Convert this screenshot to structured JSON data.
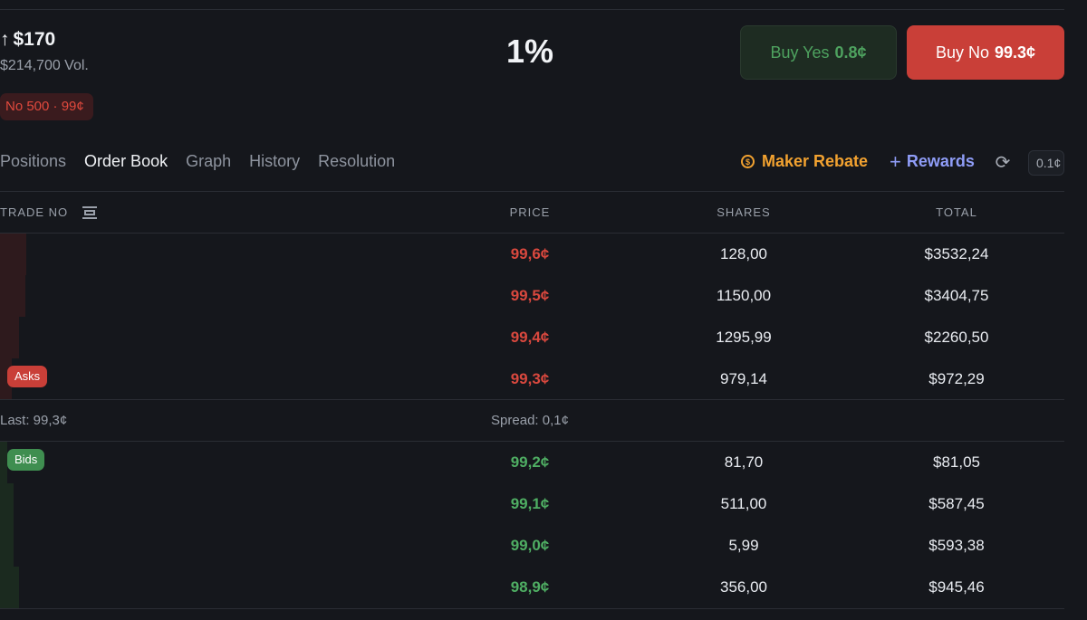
{
  "market": {
    "price_label": "$170",
    "volume": "$214,700 Vol.",
    "position_badge": "No 500 · 99¢",
    "chance": "1%"
  },
  "buttons": {
    "buy_yes_label": "Buy Yes",
    "buy_yes_price": "0.8¢",
    "buy_no_label": "Buy No",
    "buy_no_price": "99.3¢"
  },
  "tabs": [
    {
      "label": "Positions",
      "active": false
    },
    {
      "label": "Order Book",
      "active": true
    },
    {
      "label": "Graph",
      "active": false
    },
    {
      "label": "History",
      "active": false
    },
    {
      "label": "Resolution",
      "active": false
    }
  ],
  "toolbar": {
    "maker_rebate": "Maker Rebate",
    "rewards": "Rewards",
    "tick_size": "0.1¢"
  },
  "orderbook": {
    "columns": {
      "trade": "TRADE NO",
      "price": "PRICE",
      "shares": "SHARES",
      "total": "TOTAL"
    },
    "asks_label": "Asks",
    "bids_label": "Bids",
    "asks": [
      {
        "price": "99,6¢",
        "shares": "128,00",
        "total": "$3532,24",
        "depth": 0.098
      },
      {
        "price": "99,5¢",
        "shares": "1150,00",
        "total": "$3404,75",
        "depth": 0.094
      },
      {
        "price": "99,4¢",
        "shares": "1295,99",
        "total": "$2260,50",
        "depth": 0.071
      },
      {
        "price": "99,3¢",
        "shares": "979,14",
        "total": "$972,29",
        "depth": 0.043
      }
    ],
    "last": "Last: 99,3¢",
    "spread": "Spread: 0,1¢",
    "bids": [
      {
        "price": "99,2¢",
        "shares": "81,70",
        "total": "$81,05",
        "depth": 0.027
      },
      {
        "price": "99,1¢",
        "shares": "511,00",
        "total": "$587,45",
        "depth": 0.051
      },
      {
        "price": "99,0¢",
        "shares": "5,99",
        "total": "$593,38",
        "depth": 0.051
      },
      {
        "price": "98,9¢",
        "shares": "356,00",
        "total": "$945,46",
        "depth": 0.07
      }
    ]
  },
  "colors": {
    "ask": "#d9483e",
    "bid": "#4fae63",
    "maker": "#f2a230",
    "rewards": "#8f9df7"
  }
}
